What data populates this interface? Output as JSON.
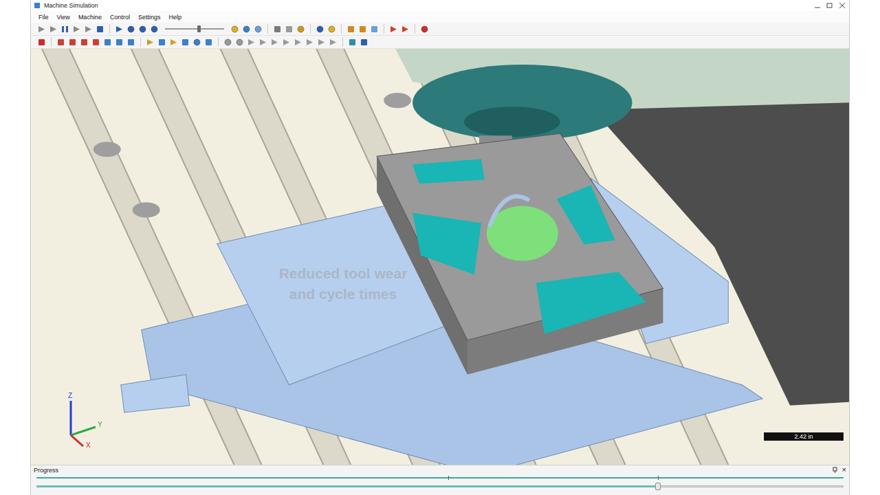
{
  "window": {
    "title": "Machine Simulation"
  },
  "menu": [
    {
      "label": "File"
    },
    {
      "label": "View"
    },
    {
      "label": "Machine"
    },
    {
      "label": "Control"
    },
    {
      "label": "Settings"
    },
    {
      "label": "Help"
    }
  ],
  "toolbar": {
    "speed_level": 0.55
  },
  "viewport": {
    "watermark": [
      "Reduced tool wear",
      "and cycle times"
    ],
    "scale": "2.42 in",
    "axes": [
      {
        "label": "Z",
        "color": "#1f3fd0"
      },
      {
        "label": "Y",
        "color": "#2fa84a"
      },
      {
        "label": "X",
        "color": "#d02a2a"
      }
    ]
  },
  "progress": {
    "title": "Progress",
    "close": "×",
    "level": 0.77
  }
}
